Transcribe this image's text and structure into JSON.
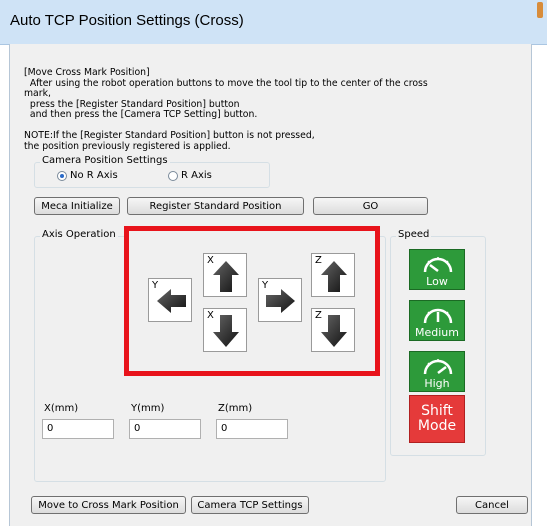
{
  "window": {
    "title": "Auto TCP Position Settings (Cross)"
  },
  "instructions": {
    "text": "[Move Cross Mark Position]\n  After using the robot operation buttons to move the tool tip to the center of the cross\nmark,\n  press the [Register Standard Position] button\n  and then press the [Camera TCP Setting] button.\n\nNOTE:If the [Register Standard Position] button is not pressed,\nthe position previously registered is applied."
  },
  "camera_position": {
    "label": "Camera Position Settings",
    "options": [
      {
        "label": "No R Axis",
        "selected": true
      },
      {
        "label": "R Axis",
        "selected": false
      }
    ]
  },
  "buttons": {
    "meca_initialize": "Meca Initialize",
    "register_standard": "Register Standard Position",
    "go": "GO",
    "move_to_cross": "Move to Cross Mark Position",
    "camera_tcp": "Camera TCP Settings",
    "cancel": "Cancel"
  },
  "axis_operation": {
    "label": "Axis Operation",
    "arrows": [
      {
        "axis": "Y",
        "direction": "left"
      },
      {
        "axis": "X",
        "direction": "up"
      },
      {
        "axis": "X",
        "direction": "down"
      },
      {
        "axis": "Y",
        "direction": "right"
      },
      {
        "axis": "Z",
        "direction": "up"
      },
      {
        "axis": "Z",
        "direction": "down"
      }
    ]
  },
  "fields": [
    {
      "label": "X(mm)",
      "value": "0"
    },
    {
      "label": "Y(mm)",
      "value": "0"
    },
    {
      "label": "Z(mm)",
      "value": "0"
    }
  ],
  "speed": {
    "label": "Speed",
    "options": [
      "Low",
      "Medium",
      "High"
    ],
    "shift_line1": "Shift",
    "shift_line2": "Mode"
  },
  "colors": {
    "highlight_border": "#e8131b",
    "speed_green": "#2d9a3a",
    "shift_red": "#e53a3a"
  }
}
